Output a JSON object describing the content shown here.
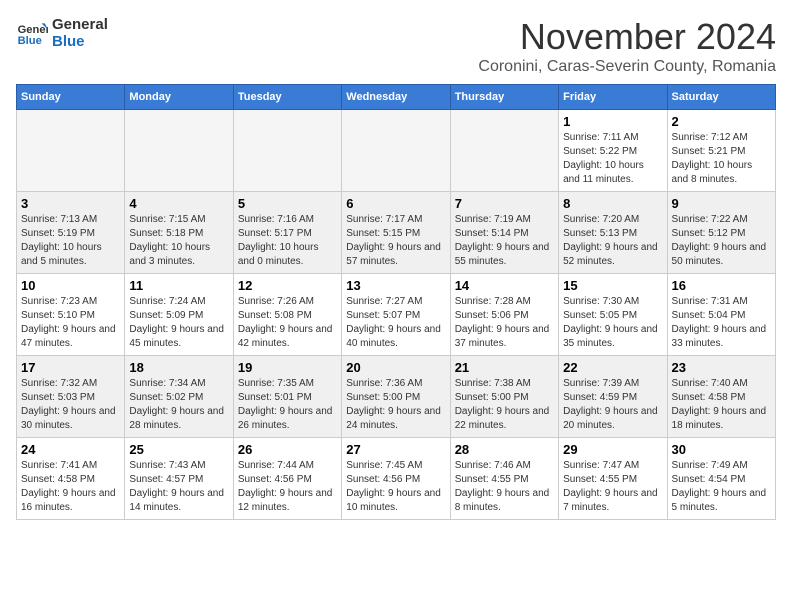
{
  "header": {
    "logo_line1": "General",
    "logo_line2": "Blue",
    "month_title": "November 2024",
    "subtitle": "Coronini, Caras-Severin County, Romania"
  },
  "weekdays": [
    "Sunday",
    "Monday",
    "Tuesday",
    "Wednesday",
    "Thursday",
    "Friday",
    "Saturday"
  ],
  "weeks": [
    [
      {
        "day": "",
        "info": "",
        "empty": true
      },
      {
        "day": "",
        "info": "",
        "empty": true
      },
      {
        "day": "",
        "info": "",
        "empty": true
      },
      {
        "day": "",
        "info": "",
        "empty": true
      },
      {
        "day": "",
        "info": "",
        "empty": true
      },
      {
        "day": "1",
        "info": "Sunrise: 7:11 AM\nSunset: 5:22 PM\nDaylight: 10 hours and 11 minutes."
      },
      {
        "day": "2",
        "info": "Sunrise: 7:12 AM\nSunset: 5:21 PM\nDaylight: 10 hours and 8 minutes."
      }
    ],
    [
      {
        "day": "3",
        "info": "Sunrise: 7:13 AM\nSunset: 5:19 PM\nDaylight: 10 hours and 5 minutes."
      },
      {
        "day": "4",
        "info": "Sunrise: 7:15 AM\nSunset: 5:18 PM\nDaylight: 10 hours and 3 minutes."
      },
      {
        "day": "5",
        "info": "Sunrise: 7:16 AM\nSunset: 5:17 PM\nDaylight: 10 hours and 0 minutes."
      },
      {
        "day": "6",
        "info": "Sunrise: 7:17 AM\nSunset: 5:15 PM\nDaylight: 9 hours and 57 minutes."
      },
      {
        "day": "7",
        "info": "Sunrise: 7:19 AM\nSunset: 5:14 PM\nDaylight: 9 hours and 55 minutes."
      },
      {
        "day": "8",
        "info": "Sunrise: 7:20 AM\nSunset: 5:13 PM\nDaylight: 9 hours and 52 minutes."
      },
      {
        "day": "9",
        "info": "Sunrise: 7:22 AM\nSunset: 5:12 PM\nDaylight: 9 hours and 50 minutes."
      }
    ],
    [
      {
        "day": "10",
        "info": "Sunrise: 7:23 AM\nSunset: 5:10 PM\nDaylight: 9 hours and 47 minutes."
      },
      {
        "day": "11",
        "info": "Sunrise: 7:24 AM\nSunset: 5:09 PM\nDaylight: 9 hours and 45 minutes."
      },
      {
        "day": "12",
        "info": "Sunrise: 7:26 AM\nSunset: 5:08 PM\nDaylight: 9 hours and 42 minutes."
      },
      {
        "day": "13",
        "info": "Sunrise: 7:27 AM\nSunset: 5:07 PM\nDaylight: 9 hours and 40 minutes."
      },
      {
        "day": "14",
        "info": "Sunrise: 7:28 AM\nSunset: 5:06 PM\nDaylight: 9 hours and 37 minutes."
      },
      {
        "day": "15",
        "info": "Sunrise: 7:30 AM\nSunset: 5:05 PM\nDaylight: 9 hours and 35 minutes."
      },
      {
        "day": "16",
        "info": "Sunrise: 7:31 AM\nSunset: 5:04 PM\nDaylight: 9 hours and 33 minutes."
      }
    ],
    [
      {
        "day": "17",
        "info": "Sunrise: 7:32 AM\nSunset: 5:03 PM\nDaylight: 9 hours and 30 minutes."
      },
      {
        "day": "18",
        "info": "Sunrise: 7:34 AM\nSunset: 5:02 PM\nDaylight: 9 hours and 28 minutes."
      },
      {
        "day": "19",
        "info": "Sunrise: 7:35 AM\nSunset: 5:01 PM\nDaylight: 9 hours and 26 minutes."
      },
      {
        "day": "20",
        "info": "Sunrise: 7:36 AM\nSunset: 5:00 PM\nDaylight: 9 hours and 24 minutes."
      },
      {
        "day": "21",
        "info": "Sunrise: 7:38 AM\nSunset: 5:00 PM\nDaylight: 9 hours and 22 minutes."
      },
      {
        "day": "22",
        "info": "Sunrise: 7:39 AM\nSunset: 4:59 PM\nDaylight: 9 hours and 20 minutes."
      },
      {
        "day": "23",
        "info": "Sunrise: 7:40 AM\nSunset: 4:58 PM\nDaylight: 9 hours and 18 minutes."
      }
    ],
    [
      {
        "day": "24",
        "info": "Sunrise: 7:41 AM\nSunset: 4:58 PM\nDaylight: 9 hours and 16 minutes."
      },
      {
        "day": "25",
        "info": "Sunrise: 7:43 AM\nSunset: 4:57 PM\nDaylight: 9 hours and 14 minutes."
      },
      {
        "day": "26",
        "info": "Sunrise: 7:44 AM\nSunset: 4:56 PM\nDaylight: 9 hours and 12 minutes."
      },
      {
        "day": "27",
        "info": "Sunrise: 7:45 AM\nSunset: 4:56 PM\nDaylight: 9 hours and 10 minutes."
      },
      {
        "day": "28",
        "info": "Sunrise: 7:46 AM\nSunset: 4:55 PM\nDaylight: 9 hours and 8 minutes."
      },
      {
        "day": "29",
        "info": "Sunrise: 7:47 AM\nSunset: 4:55 PM\nDaylight: 9 hours and 7 minutes."
      },
      {
        "day": "30",
        "info": "Sunrise: 7:49 AM\nSunset: 4:54 PM\nDaylight: 9 hours and 5 minutes."
      }
    ]
  ]
}
